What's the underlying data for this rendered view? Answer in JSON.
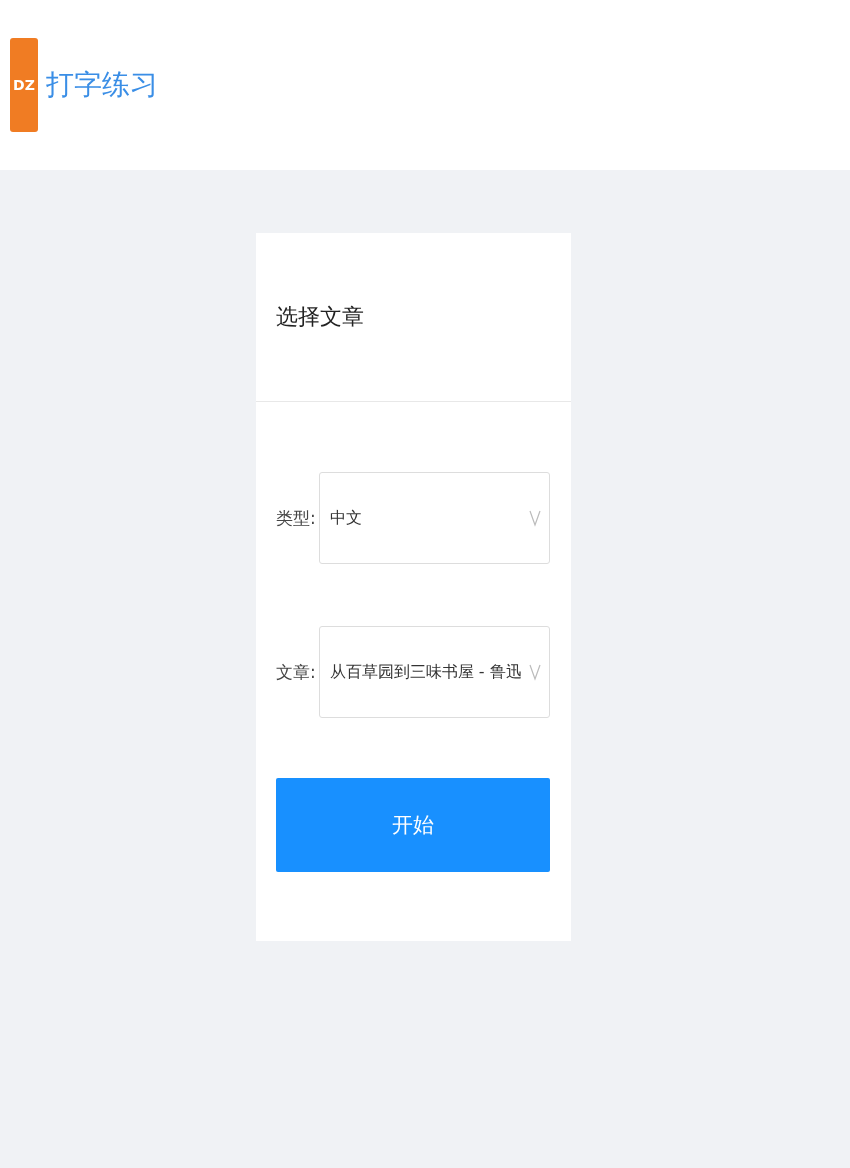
{
  "header": {
    "logo": "DZ",
    "title": "打字练习"
  },
  "card": {
    "title": "选择文章",
    "fields": [
      {
        "label": "类型:",
        "value": "中文"
      },
      {
        "label": "文章:",
        "value": "从百草园到三味书屋 - 鲁迅"
      }
    ],
    "button": "开始"
  }
}
